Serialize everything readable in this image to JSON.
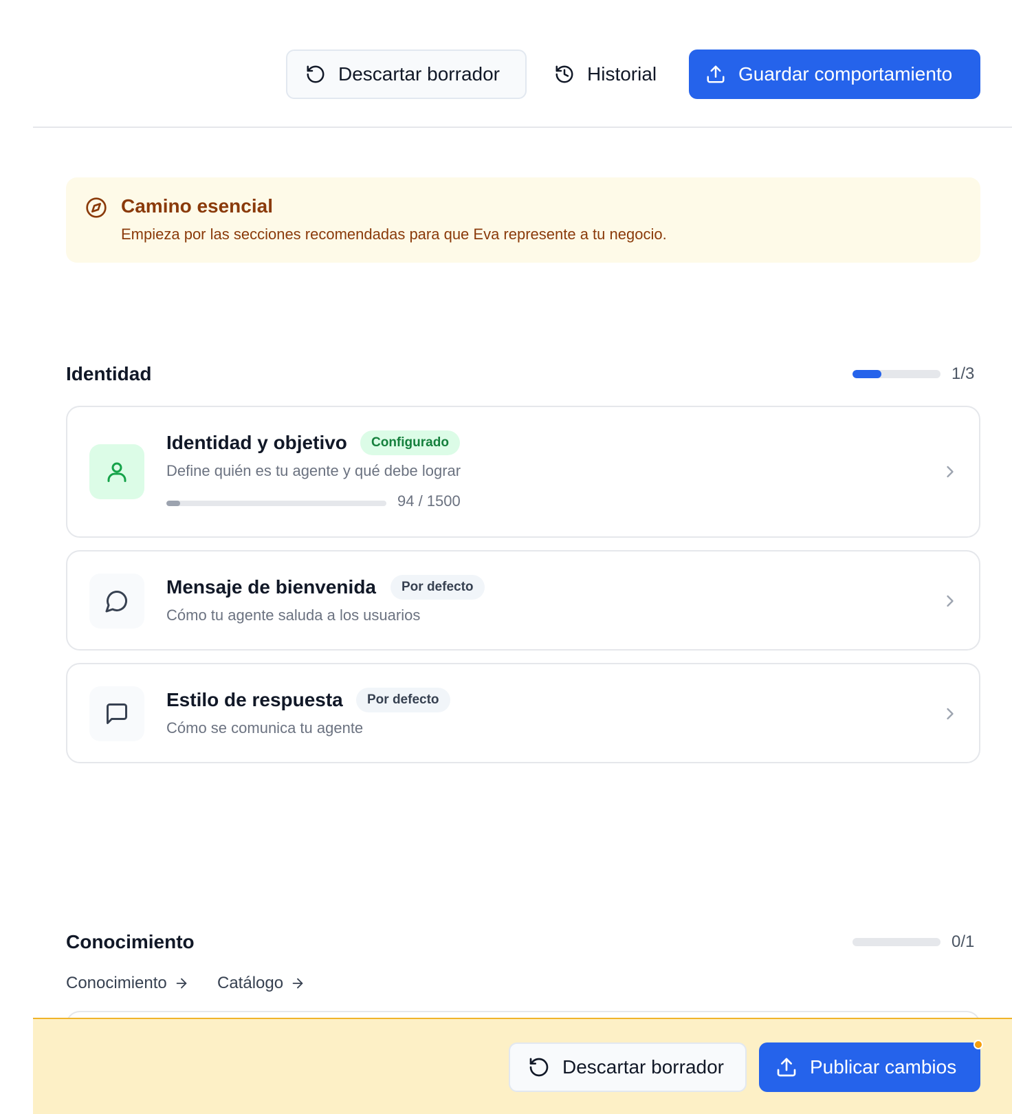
{
  "toolbar": {
    "discard_label": "Descartar borrador",
    "history_label": "Historial",
    "save_label": "Guardar comportamiento"
  },
  "notice": {
    "title": "Camino esencial",
    "subtitle": "Empieza por las secciones recomendadas para que Eva represente a tu negocio.",
    "icon": "compass-icon"
  },
  "sections": {
    "identity": {
      "title": "Identidad",
      "count": "1/3",
      "progress": 0.33,
      "cards": [
        {
          "title": "Identidad y objetivo",
          "badge": "Configurado",
          "subtitle": "Define quién es tu agente y qué debe lograr",
          "counter": "94 / 1500",
          "progress": 0.063,
          "icon": "user-icon"
        },
        {
          "title": "Mensaje de bienvenida",
          "badge": "Por defecto",
          "subtitle": "Cómo tu agente saluda a los usuarios",
          "icon": "chat-bubble-icon"
        },
        {
          "title": "Estilo de respuesta",
          "badge": "Por defecto",
          "subtitle": "Cómo se comunica tu agente",
          "icon": "message-square-icon"
        }
      ]
    },
    "knowledge": {
      "title": "Conocimiento",
      "count": "0/1",
      "progress": 0,
      "links": [
        "Conocimiento",
        "Catálogo"
      ]
    }
  },
  "bottombar": {
    "discard_label": "Descartar borrador",
    "publish_label": "Publicar cambios"
  },
  "colors": {
    "primary": "#2563eb",
    "notice_bg": "#fefae8",
    "notice_text": "#8a3a0a",
    "success_bg": "#dcfce7",
    "success_text": "#15803d",
    "bottombar_bg": "#fdf0c6",
    "indicator": "#f59e0b"
  }
}
